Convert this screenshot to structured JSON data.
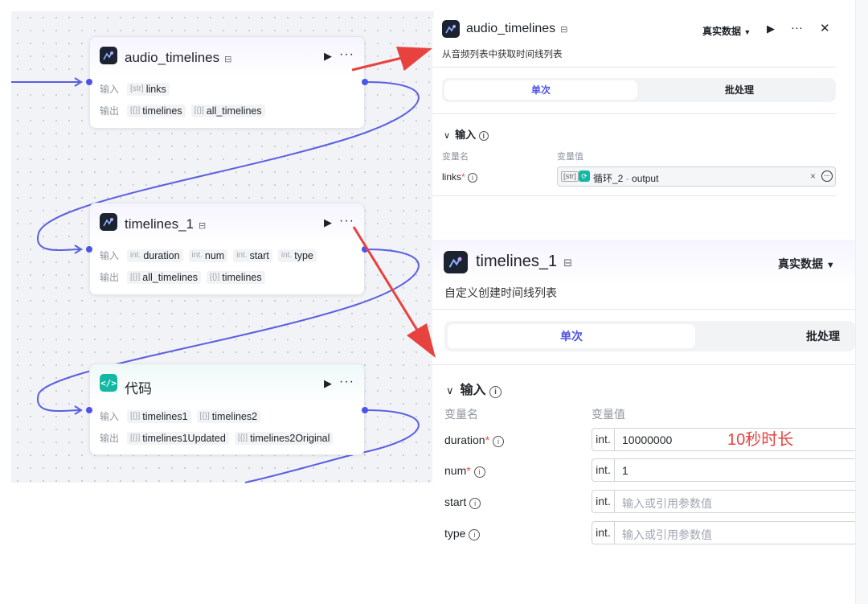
{
  "canvas": {
    "nodes": [
      {
        "title": "audio_timelines",
        "template_mark": "⊟",
        "inputs_label": "输入",
        "outputs_label": "输出",
        "inputs": [
          {
            "type": "[str]",
            "name": "links"
          }
        ],
        "outputs": [
          {
            "type": "[{}]",
            "name": "timelines"
          },
          {
            "type": "[{}]",
            "name": "all_timelines"
          }
        ]
      },
      {
        "title": "timelines_1",
        "template_mark": "⊟",
        "inputs_label": "输入",
        "outputs_label": "输出",
        "inputs": [
          {
            "type": "int.",
            "name": "duration"
          },
          {
            "type": "int.",
            "name": "num"
          },
          {
            "type": "int.",
            "name": "start"
          },
          {
            "type": "int.",
            "name": "type"
          }
        ],
        "outputs": [
          {
            "type": "[{}]",
            "name": "all_timelines"
          },
          {
            "type": "[{}]",
            "name": "timelines"
          }
        ]
      },
      {
        "title": "代码",
        "inputs_label": "输入",
        "outputs_label": "输出",
        "inputs": [
          {
            "type": "[{}]",
            "name": "timelines1"
          },
          {
            "type": "[{}]",
            "name": "timelines2"
          }
        ],
        "outputs": [
          {
            "type": "[{}]",
            "name": "timelines1Updated"
          },
          {
            "type": "[{}]",
            "name": "timelines2Original"
          }
        ]
      }
    ]
  },
  "panel_audio": {
    "title": "audio_timelines",
    "template_mark": "⊟",
    "data_mode": "真实数据",
    "description": "从音频列表中获取时间线列表",
    "tab_single": "单次",
    "tab_batch": "批处理",
    "section_input": "输入",
    "col_var_name": "变量名",
    "col_var_value": "变量值",
    "field": {
      "name": "links",
      "required_mark": "*",
      "type": "[str]",
      "ref_source": "循环_2",
      "ref_sep": "-",
      "ref_output": "output",
      "clear": "×"
    }
  },
  "panel_timelines": {
    "title": "timelines_1",
    "template_mark": "⊟",
    "data_mode": "真实数据",
    "description": "自定义创建时间线列表",
    "tab_single": "单次",
    "tab_batch": "批处理",
    "section_input": "输入",
    "col_var_name": "变量名",
    "col_var_value": "变量值",
    "annotation": "10秒时长",
    "fields": [
      {
        "name": "duration",
        "required_mark": "*",
        "type": "int.",
        "value": "10000000",
        "placeholder": ""
      },
      {
        "name": "num",
        "required_mark": "*",
        "type": "int.",
        "value": "1",
        "placeholder": ""
      },
      {
        "name": "start",
        "required_mark": "",
        "type": "int.",
        "value": "",
        "placeholder": "输入或引用参数值"
      },
      {
        "name": "type",
        "required_mark": "",
        "type": "int.",
        "value": "",
        "placeholder": "输入或引用参数值"
      }
    ]
  },
  "icons": {
    "play": "▶",
    "more": "···",
    "close": "✕",
    "dropdown": "▼",
    "collapse": "∨",
    "info": "i"
  },
  "colors": {
    "accent": "#4d53e8",
    "edge": "#5a5fe0",
    "arrow": "#e8423f",
    "annotation": "#e8423f",
    "code_icon_bg": "#13b8a4",
    "loop_chip": "#13b8a4"
  }
}
